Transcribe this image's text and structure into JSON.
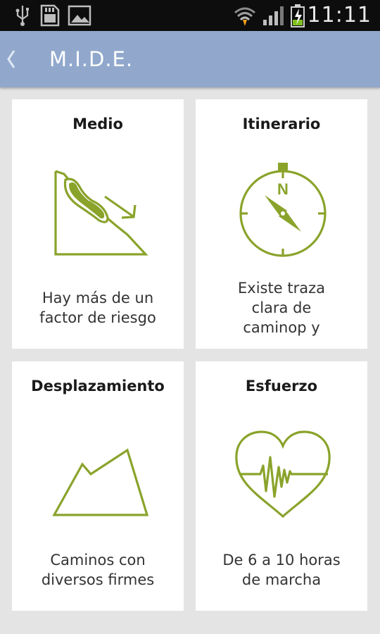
{
  "status_bar": {
    "time": "11:11",
    "icons": [
      "usb-icon",
      "sd-card-icon",
      "image-icon",
      "wifi-icon",
      "signal-icon",
      "battery-charging-icon"
    ]
  },
  "action_bar": {
    "title": "M.I.D.E.",
    "back_icon": "chevron-left-icon"
  },
  "colors": {
    "accent": "#8aa32b",
    "action_bar": "#91a8cc",
    "background": "#e4e4e4"
  },
  "cards": [
    {
      "title": "Medio",
      "icon": "slope-risk-icon",
      "description_lines": [
        "Hay más de un",
        "factor de riesgo"
      ]
    },
    {
      "title": "Itinerario",
      "icon": "compass-icon",
      "description_lines": [
        "Existe traza",
        "clara de",
        "caminop y"
      ]
    },
    {
      "title": "Desplazamiento",
      "icon": "terrain-icon",
      "description_lines": [
        "Caminos con",
        "diversos firmes"
      ]
    },
    {
      "title": "Esfuerzo",
      "icon": "heart-rate-icon",
      "description_lines": [
        "De 6 a 10 horas",
        "de marcha"
      ]
    }
  ]
}
